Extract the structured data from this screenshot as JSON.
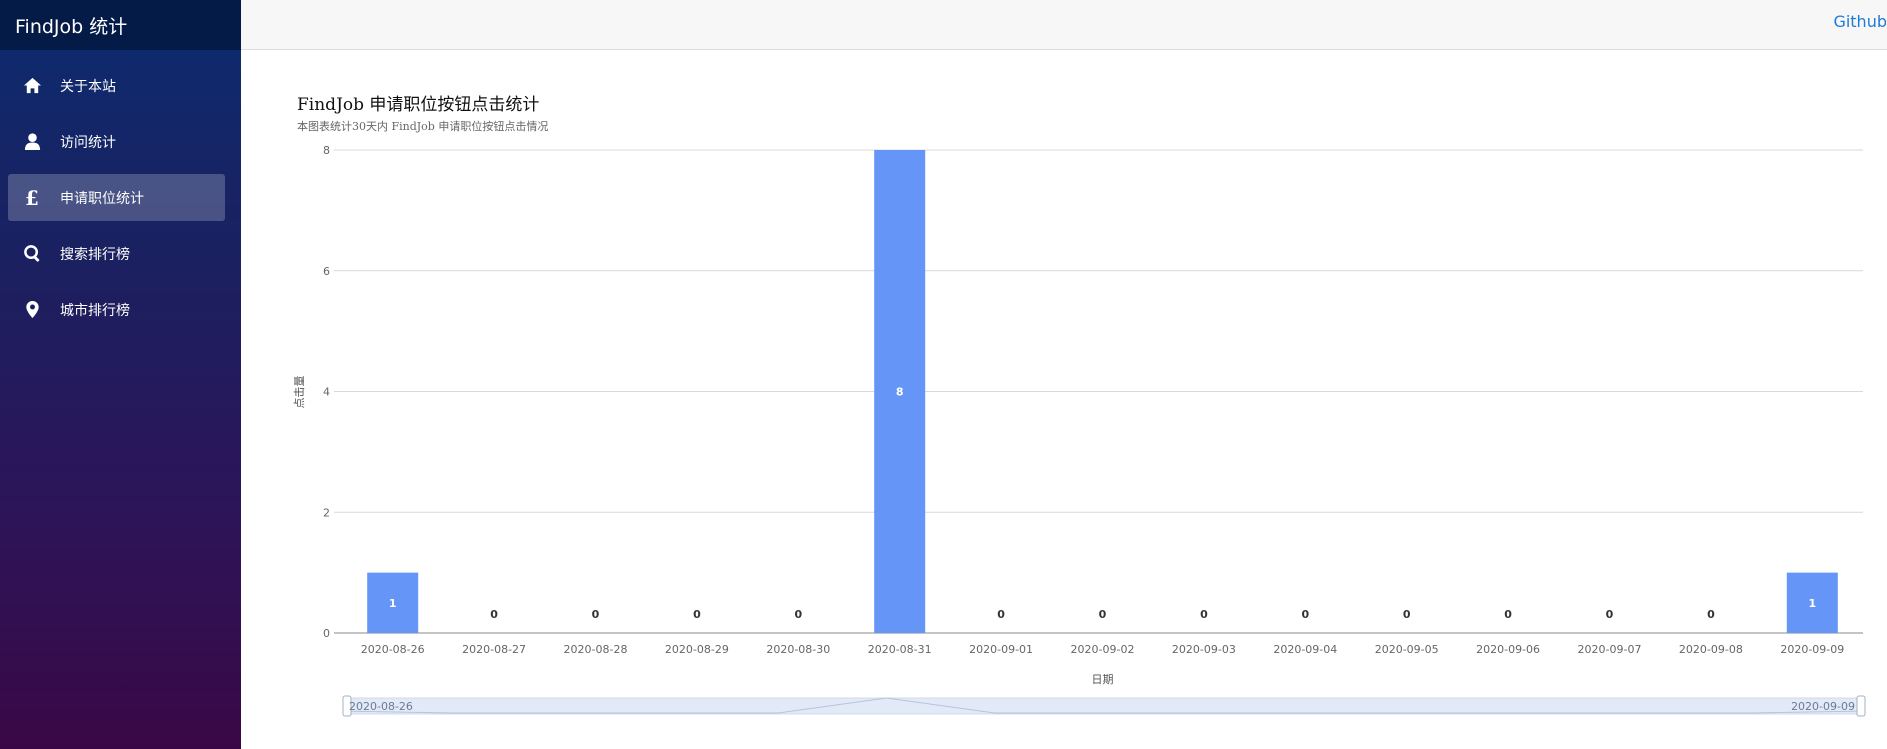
{
  "app": {
    "brand": "FindJob 统计"
  },
  "sidebar": {
    "items": [
      {
        "label": "关于本站",
        "icon": "home-icon",
        "active": false
      },
      {
        "label": "访问统计",
        "icon": "user-icon",
        "active": false
      },
      {
        "label": "申请职位统计",
        "icon": "pound-icon",
        "active": true
      },
      {
        "label": "搜索排行榜",
        "icon": "search-icon",
        "active": false
      },
      {
        "label": "城市排行榜",
        "icon": "map-marker-icon",
        "active": false
      }
    ]
  },
  "topbar": {
    "github_label": "Github"
  },
  "chart": {
    "title": "FindJob 申请职位按钮点击统计",
    "subtitle": "本图表统计30天内 FindJob 申请职位按钮点击情况",
    "zoom_start_label": "2020-08-26",
    "zoom_end_label": "2020-09-09"
  },
  "chart_data": {
    "type": "bar",
    "title": "FindJob 申请职位按钮点击统计",
    "subtitle": "本图表统计30天内 FindJob 申请职位按钮点击情况",
    "xlabel": "日期",
    "ylabel": "点击量",
    "categories": [
      "2020-08-26",
      "2020-08-27",
      "2020-08-28",
      "2020-08-29",
      "2020-08-30",
      "2020-08-31",
      "2020-09-01",
      "2020-09-02",
      "2020-09-03",
      "2020-09-04",
      "2020-09-05",
      "2020-09-06",
      "2020-09-07",
      "2020-09-08",
      "2020-09-09"
    ],
    "values": [
      1,
      0,
      0,
      0,
      0,
      8,
      0,
      0,
      0,
      0,
      0,
      0,
      0,
      0,
      1
    ],
    "ylim": [
      0,
      8
    ],
    "yticks": [
      0,
      2,
      4,
      6,
      8
    ],
    "grid": true,
    "color": "#6495f7",
    "data_labels": true,
    "zoom_range": [
      "2020-08-26",
      "2020-09-09"
    ]
  }
}
